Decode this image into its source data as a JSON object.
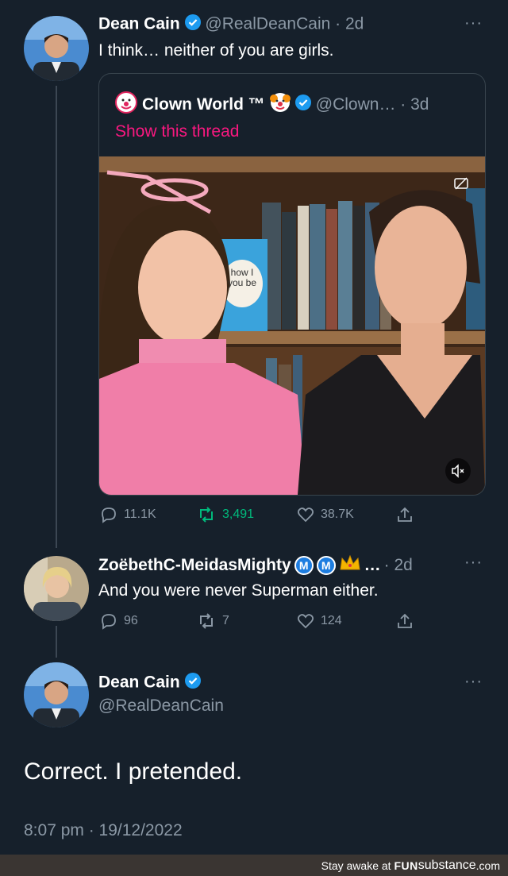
{
  "tweet1": {
    "name": "Dean Cain",
    "handle_time": "@RealDeanCain · 2d",
    "text": "I think… neither of you are girls.",
    "more": "···"
  },
  "quote": {
    "name": "Clown World ™",
    "handle_time": "@Clown… · 3d",
    "show_thread": "Show this thread",
    "video_book_text": "how I\nyou be",
    "stats": {
      "replies": "11.1K",
      "retweets": "3,491",
      "likes": "38.7K"
    }
  },
  "reply": {
    "name": "ZoëbethC-MeidasMighty",
    "badge_m": "M",
    "ellipsis": "…",
    "time": "· 2d",
    "text": "And you were never Superman either.",
    "more": "···",
    "stats": {
      "replies": "96",
      "retweets": "7",
      "likes": "124"
    }
  },
  "main_tweet": {
    "name": "Dean Cain",
    "handle": "@RealDeanCain",
    "text": "Correct. I pretended.",
    "timestamp": "8:07 pm · 19/12/2022",
    "more": "···"
  },
  "footer": {
    "prefix": "Stay awake at ",
    "brand_a": "FUN",
    "brand_b": "substance",
    "brand_c": ".com"
  },
  "colors": {
    "background": "#16202b",
    "link_pink": "#f91880",
    "verified": "#1d9bf0",
    "retweet_green": "#00ba7c",
    "muted": "#8b98a5"
  }
}
